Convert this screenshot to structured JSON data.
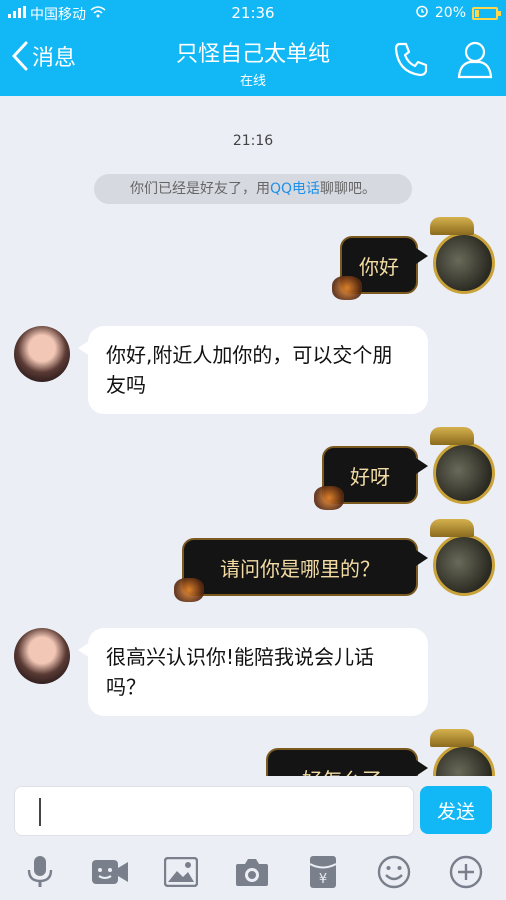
{
  "status_bar": {
    "carrier": "中国移动",
    "time": "21:36",
    "battery": "20%"
  },
  "header": {
    "back_label": "消息",
    "title": "只怪自己太单纯",
    "subtitle": "在线",
    "phone_icon": "phone-icon",
    "profile_icon": "profile-icon"
  },
  "chat": {
    "timestamp": "21:16",
    "system_message": {
      "before": "你们已经是好友了，用",
      "link": "QQ电话",
      "after": "聊聊吧。"
    },
    "messages": [
      {
        "side": "right",
        "text": "你好"
      },
      {
        "side": "left",
        "text": "你好,附近人加你的，可以交个朋友吗"
      },
      {
        "side": "right",
        "text": "好呀"
      },
      {
        "side": "right",
        "text": "请问你是哪里的？"
      },
      {
        "side": "left",
        "text": "很高兴认识你!能陪我说会儿话吗？"
      },
      {
        "side": "right",
        "text": "好怎么了"
      }
    ]
  },
  "input": {
    "placeholder": "",
    "send_label": "发送"
  },
  "toolbar": {
    "icons": [
      "microphone-icon",
      "video-icon",
      "image-icon",
      "camera-icon",
      "red-packet-icon",
      "emoji-icon",
      "plus-icon"
    ]
  },
  "colors": {
    "accent": "#12b7f5",
    "background": "#eceef5",
    "link": "#1e90e8",
    "bubble_dark": "#141414",
    "bubble_gold_text": "#f3dba4"
  }
}
